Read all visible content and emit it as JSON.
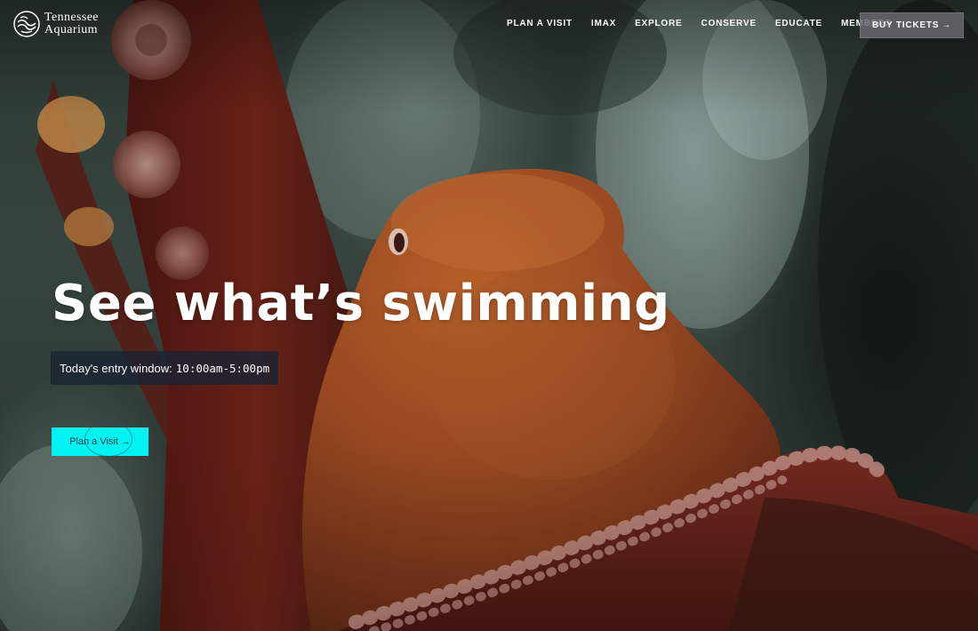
{
  "header": {
    "logo": {
      "line1": "Tennessee",
      "line2": "Aquarium"
    },
    "nav": [
      {
        "label": "PLAN A VISIT"
      },
      {
        "label": "IMAX"
      },
      {
        "label": "EXPLORE"
      },
      {
        "label": "CONSERVE"
      },
      {
        "label": "EDUCATE"
      },
      {
        "label": "MEMBERS"
      }
    ],
    "buy_button": {
      "label": "BUY TICKETS",
      "icon": "arrow-right-icon"
    }
  },
  "hero": {
    "headline": "See what’s swimming",
    "entry_window": {
      "label": "Today's entry window:",
      "time": "10:00am-5:00pm"
    },
    "cta": {
      "label": "Plan a Visit",
      "icon": "arrow-right-icon",
      "background": "#00f2f2"
    },
    "background_image": "octopus-photo"
  },
  "colors": {
    "cta": "#00f2f2",
    "entry_bg": "#182234",
    "buy_button_bg": "#69696e",
    "text": "#ffffff"
  }
}
